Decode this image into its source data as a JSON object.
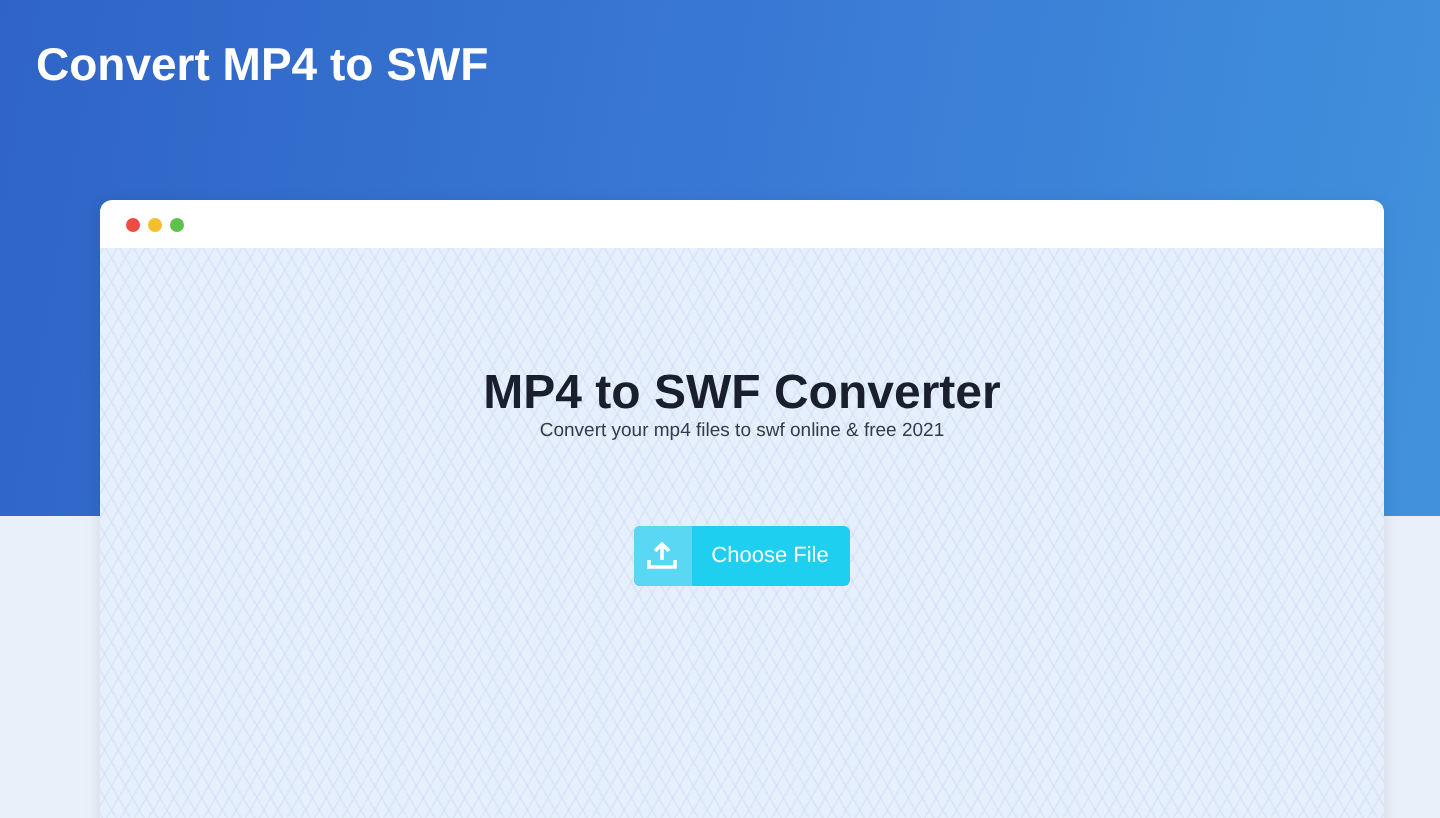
{
  "page_title": "Convert MP4 to SWF",
  "converter": {
    "title": "MP4 to SWF Converter",
    "subtitle": "Convert your mp4 files to swf online & free 2021",
    "button": "Choose File"
  }
}
